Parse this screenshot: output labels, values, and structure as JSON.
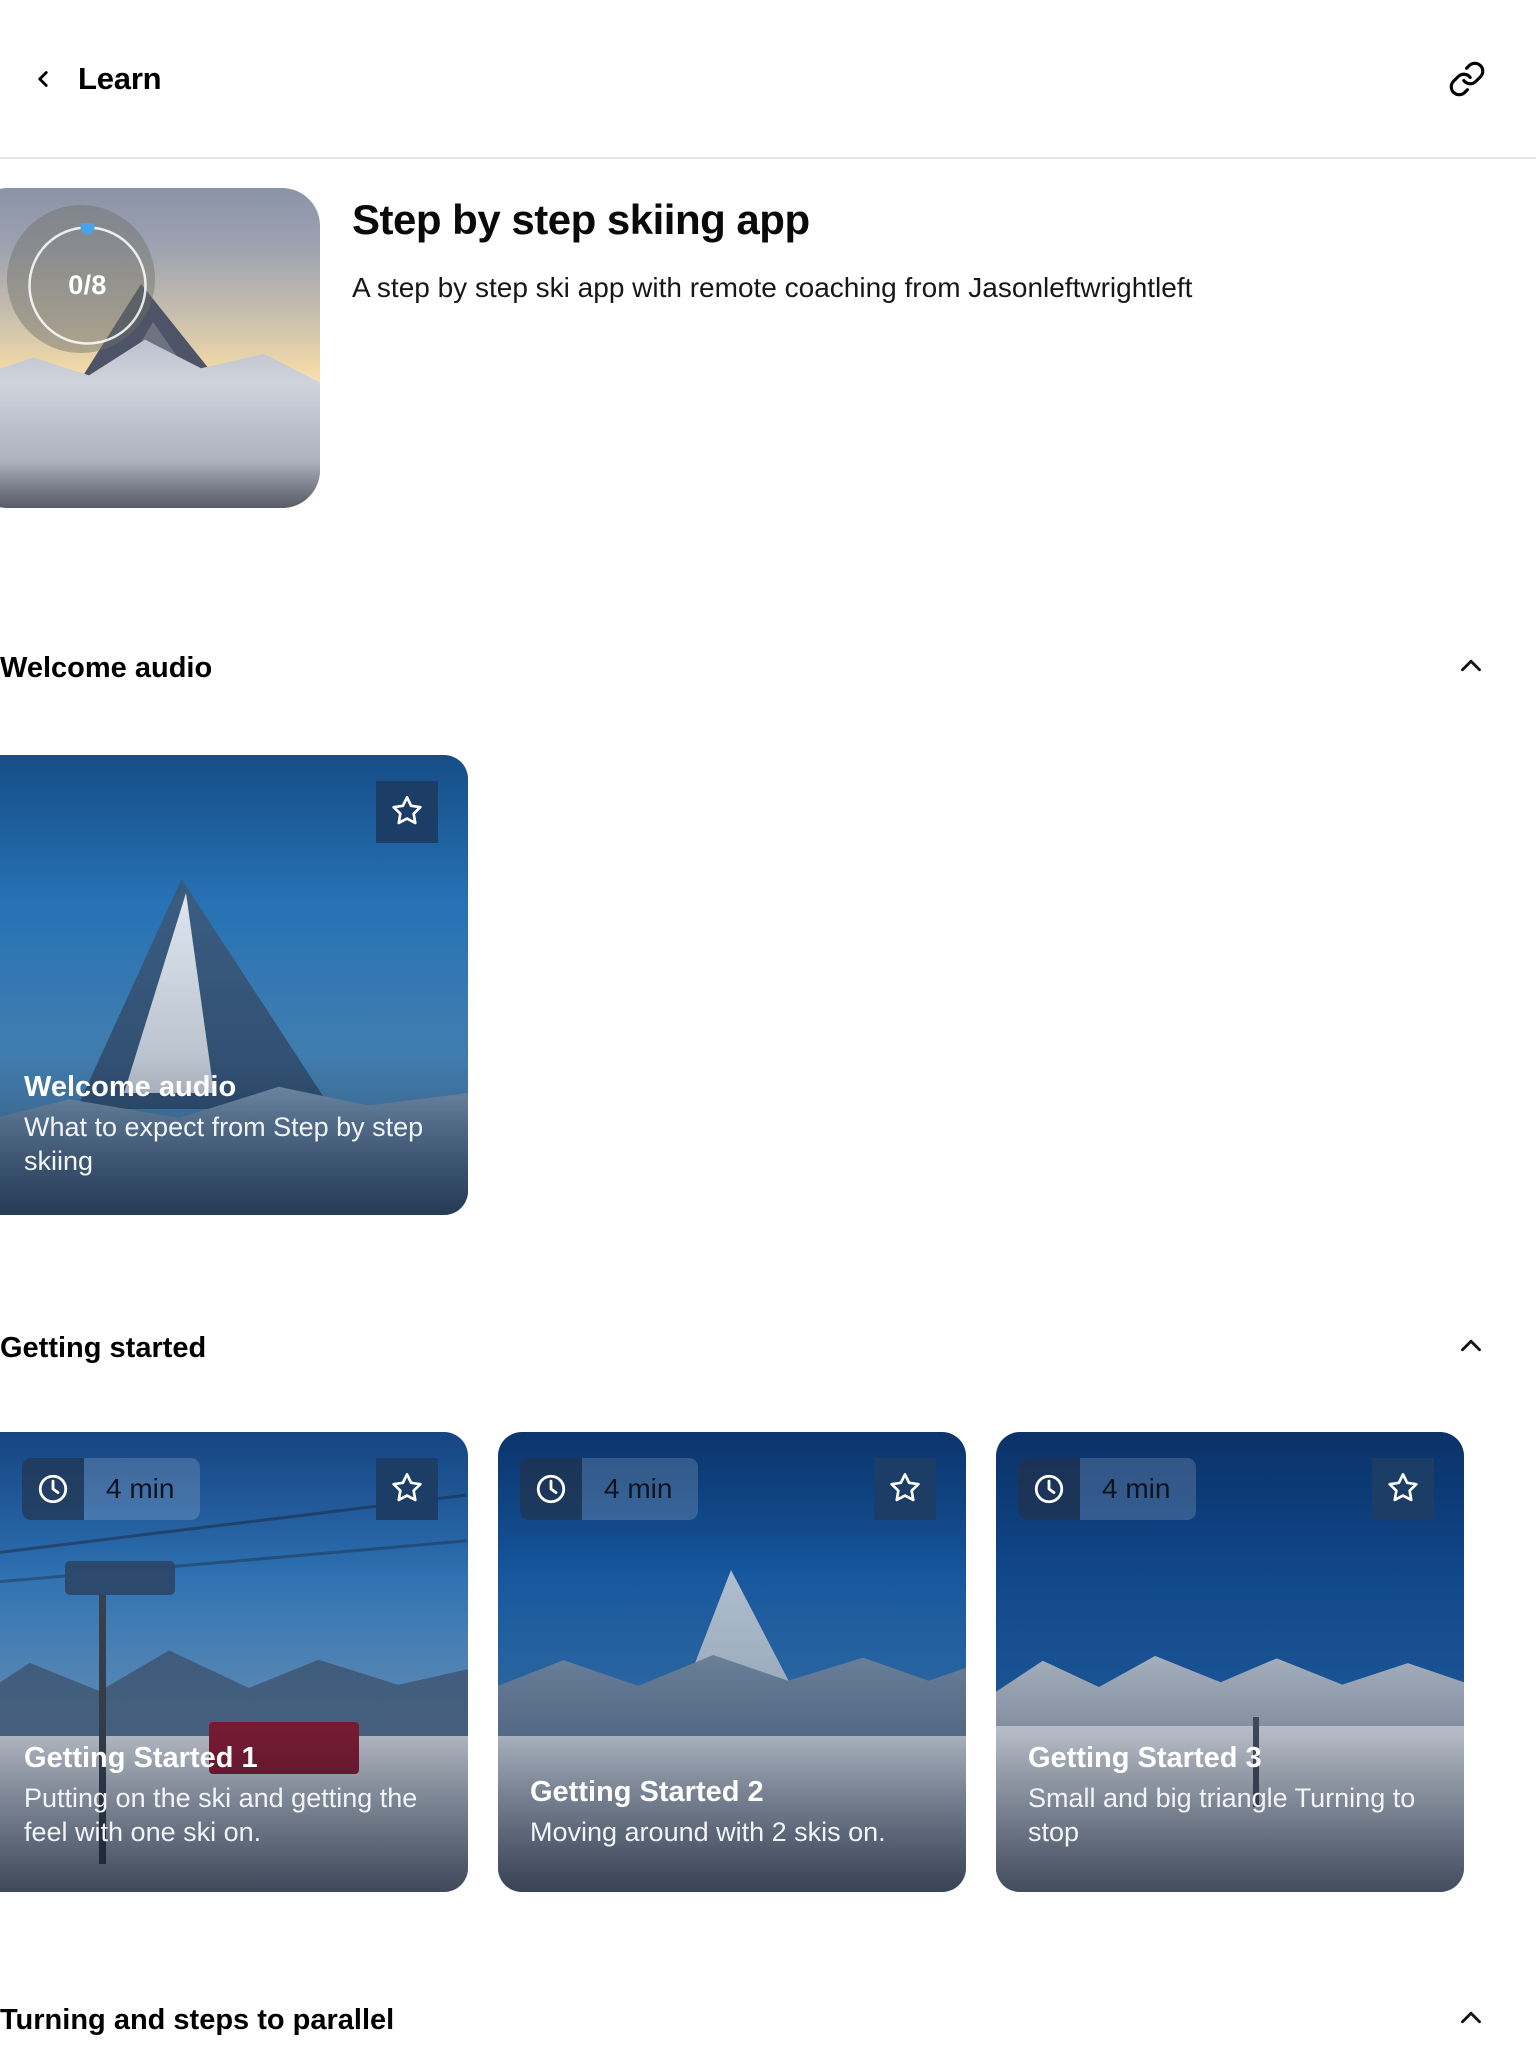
{
  "header": {
    "back_label": "Learn",
    "back_icon": "chevron-left-icon",
    "link_icon": "link-icon"
  },
  "course": {
    "title": "Step by step skiing app",
    "subtitle": "A step by step ski app with remote coaching from Jasonleftwrightleft",
    "progress_label": "0/8",
    "progress_completed": 0,
    "progress_total": 8,
    "thumbnail_alt": "matterhorn-sunset"
  },
  "sections": [
    {
      "title": "Welcome audio",
      "collapse_icon": "chevron-up-icon",
      "expanded": true,
      "cards": [
        {
          "title": "Welcome audio",
          "description": "What to expect from Step by step skiing",
          "duration": null,
          "star_icon": "star-outline-icon",
          "favorited": false
        }
      ]
    },
    {
      "title": "Getting started",
      "collapse_icon": "chevron-up-icon",
      "expanded": true,
      "cards": [
        {
          "title": "Getting Started 1",
          "description": "Putting on the ski and getting the feel with one ski on.",
          "duration": "4 min",
          "duration_icon": "clock-icon",
          "star_icon": "star-outline-icon",
          "favorited": false
        },
        {
          "title": "Getting Started 2",
          "description": "Moving around with 2 skis on.",
          "duration": "4 min",
          "duration_icon": "clock-icon",
          "star_icon": "star-outline-icon",
          "favorited": false
        },
        {
          "title": "Getting Started 3",
          "description": "Small and big triangle Turning to stop",
          "duration": "4 min",
          "duration_icon": "clock-icon",
          "star_icon": "star-outline-icon",
          "favorited": false
        }
      ]
    },
    {
      "title": "Turning and steps to parallel",
      "collapse_icon": "chevron-up-icon",
      "expanded": true,
      "cards": []
    }
  ],
  "colors": {
    "background": "#ffffff",
    "text_primary": "#000000",
    "divider": "#e3e5ea",
    "badge_navy": "#1b3d66",
    "progress_dot": "#4aa3e8"
  }
}
